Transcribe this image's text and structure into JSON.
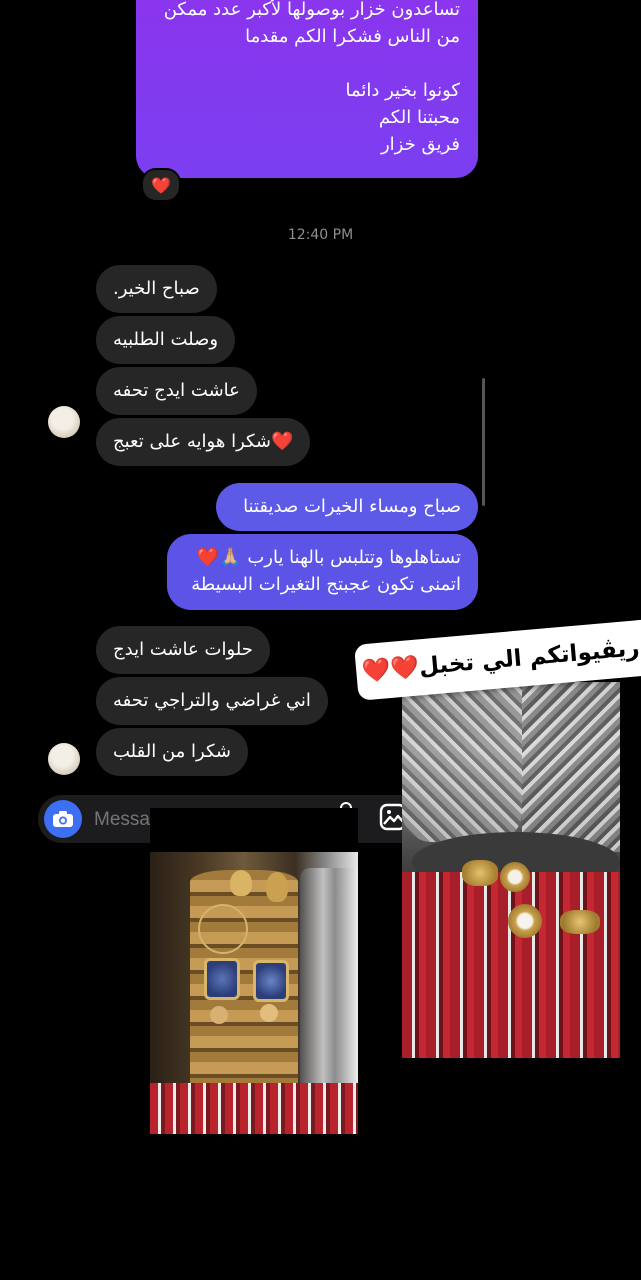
{
  "chat": {
    "outgoing_first": {
      "lines": [
        "تساعدون خزار بوصولها لأكبر عدد ممكن",
        "من الناس فشكرا الكم مقدما",
        "",
        "كونوا بخير دائما",
        "محبتنا الكم",
        "فريق خزار"
      ],
      "reaction": "❤️"
    },
    "timestamp": "12:40 PM",
    "incoming_group_1": [
      "صباح الخير.",
      "وصلت الطلبيه",
      "عاشت ايدج تحفه",
      "❤️شكرا  هوايه على تعبج"
    ],
    "outgoing_group": [
      "صباح ومساء الخيرات صديقتنا",
      "تستاهلوها وتتلبس بالهنا يارب 🙏🏼❤️",
      "اتمنى تكون عجبتج التغيرات البسيطة"
    ],
    "incoming_group_2": [
      "حلوات عاشت ايدج",
      "اني غراضي والتراجي تحفه",
      "شكرا من القلب"
    ],
    "composer_placeholder": "Message..."
  },
  "overlay": {
    "sticker_text": "ريڤيواتكم الي تخبل❤️❤️"
  },
  "colors": {
    "outgoing_purple": "#7a3ff2",
    "outgoing_blue": "#5b56e6",
    "incoming": "#262626",
    "camera_button": "#3d6ff5"
  },
  "icons": [
    "camera-icon",
    "image-icon",
    "mic-icon",
    "heart-icon"
  ]
}
